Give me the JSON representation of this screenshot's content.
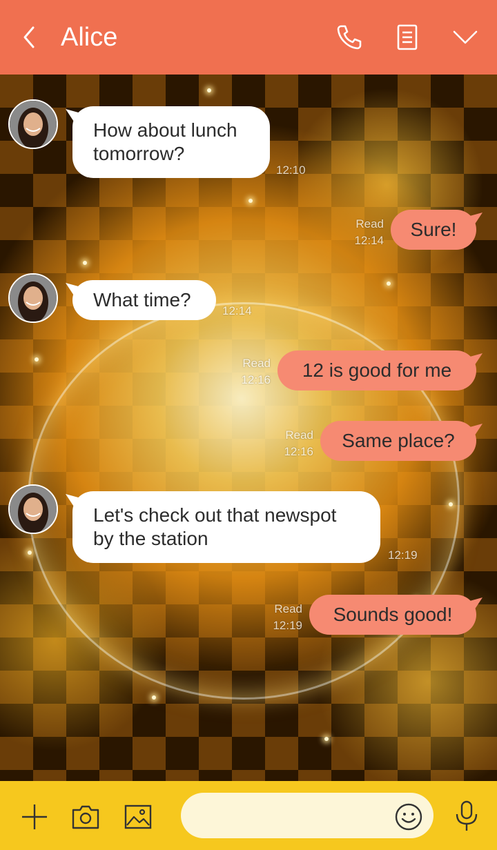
{
  "header": {
    "title": "Alice",
    "back_icon": "chevron-left-icon",
    "phone_icon": "phone-icon",
    "notes_icon": "notes-icon",
    "menu_icon": "chevron-down-icon",
    "background_color": "#F07050"
  },
  "messages": [
    {
      "side": "in",
      "text_lines": [
        "How about lunch",
        "tomorrow?"
      ],
      "time": "12:10"
    },
    {
      "side": "out",
      "text": "Sure!",
      "status": "Read",
      "time": "12:14"
    },
    {
      "side": "in",
      "text_lines": [
        "What time?"
      ],
      "time": "12:14"
    },
    {
      "side": "out",
      "text": "12 is good for me",
      "status": "Read",
      "time": "12:16"
    },
    {
      "side": "out",
      "text": "Same place?",
      "status": "Read",
      "time": "12:16"
    },
    {
      "side": "in",
      "text_lines": [
        "Let's check out that newspot",
        "by the station"
      ],
      "time": "12:19"
    },
    {
      "side": "out",
      "text": "Sounds good!",
      "status": "Read",
      "time": "12:19"
    }
  ],
  "composer": {
    "placeholder": "",
    "value": "",
    "plus_icon": "plus-icon",
    "camera_icon": "camera-icon",
    "image_icon": "image-icon",
    "emoji_icon": "emoji-icon",
    "mic_icon": "microphone-icon",
    "background_color": "#F6C81E"
  },
  "colors": {
    "outgoing_bubble": "#F68A72",
    "incoming_bubble": "#FFFFFF"
  }
}
